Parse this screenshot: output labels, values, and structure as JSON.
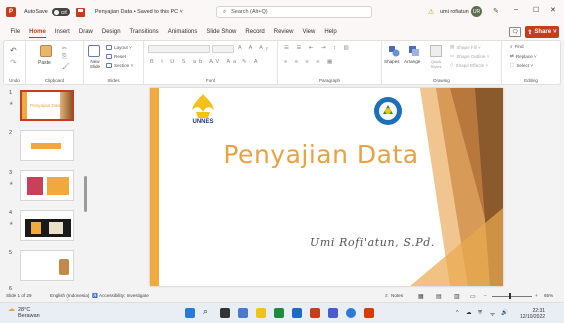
{
  "titlebar": {
    "autosave_label": "AutoSave",
    "autosave_state": "Off",
    "document_title": "Penyajian Data • Saved to this PC ˅",
    "search_placeholder": "Search (Alt+Q)",
    "user_name": "umi rofiatun",
    "user_initials": "UR",
    "minimize": "–",
    "restore": "☐",
    "close": "✕"
  },
  "menu": {
    "tabs": [
      "File",
      "Home",
      "Insert",
      "Draw",
      "Design",
      "Transitions",
      "Animations",
      "Slide Show",
      "Record",
      "Review",
      "View",
      "Help"
    ],
    "active_tab": "Home",
    "share_label": "Share"
  },
  "ribbon": {
    "groups": {
      "undo": "Undo",
      "clipboard": "Clipboard",
      "slides": "Slides",
      "font": "Font",
      "paragraph": "Paragraph",
      "drawing": "Drawing",
      "editing": "Editing"
    },
    "paste_label": "Paste",
    "new_slide_label": "New Slide",
    "layout_label": "Layout ˅",
    "reset_label": "Reset",
    "section_label": "Section ˅",
    "shapes_label": "Shapes",
    "arrange_label": "Arrange",
    "quick_styles_label": "Quick Styles",
    "shape_fill_label": "Shape Fill ˅",
    "shape_outline_label": "Shape Outline ˅",
    "shape_effects_label": "Shape Effects ˅",
    "find_label": "Find",
    "replace_label": "Replace ˅",
    "select_label": "Select ˅"
  },
  "thumbnails": [
    {
      "number": "1",
      "caption": "Penyajian Data",
      "active": true
    },
    {
      "number": "2",
      "caption": "",
      "active": false
    },
    {
      "number": "3",
      "caption": "",
      "active": false
    },
    {
      "number": "4",
      "caption": "",
      "active": false
    },
    {
      "number": "5",
      "caption": "",
      "active": false
    },
    {
      "number": "6",
      "caption": "",
      "active": false
    }
  ],
  "slide": {
    "title": "Penyajian Data",
    "author": "Umi Rofi'atun, S.Pd.",
    "logo_left_text": "UNNES"
  },
  "statusbar": {
    "slide_count": "Slide 1 of 29",
    "language": "English (Indonesia)",
    "accessibility": "Accessibility: Investigate",
    "notes": "Notes",
    "zoom": "65%"
  },
  "taskbar": {
    "temperature": "28°C",
    "weather": "Berawan",
    "time": "22:31",
    "date": "12/10/2022"
  },
  "colors": {
    "accent": "#c43e1c",
    "title_orange": "#e8a244",
    "slide_gold": "#f0a93c",
    "slide_brown": "#b8773d"
  }
}
